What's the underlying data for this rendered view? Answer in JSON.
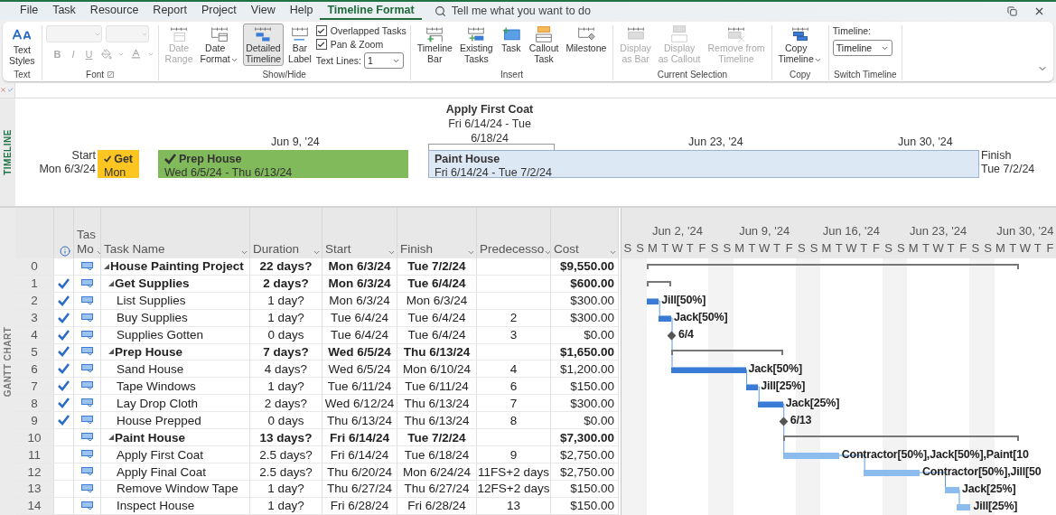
{
  "menu": {
    "tabs": [
      {
        "label": "File",
        "selected": false
      },
      {
        "label": "Task",
        "selected": false
      },
      {
        "label": "Resource",
        "selected": false
      },
      {
        "label": "Report",
        "selected": false
      },
      {
        "label": "Project",
        "selected": false
      },
      {
        "label": "View",
        "selected": false
      },
      {
        "label": "Help",
        "selected": false
      },
      {
        "label": "Timeline Format",
        "selected": true
      }
    ],
    "search": {
      "placeholder": "Tell me what you want to do"
    }
  },
  "ribbon": {
    "groups": [
      {
        "kind": "buttons",
        "label": "Text",
        "buttons": [
          {
            "label": "Text\nStyles",
            "disabled": false,
            "pressed": false,
            "dropdown": false
          }
        ]
      },
      {
        "kind": "font",
        "label": "Font",
        "disabled": true,
        "format_buttons": [
          "B",
          "I",
          "U"
        ]
      },
      {
        "kind": "buttons",
        "label": "Show/Hide",
        "buttons": [
          {
            "label": "Date\nRange",
            "disabled": true,
            "pressed": false,
            "dropdown": false
          },
          {
            "label": "Date\nFormat",
            "disabled": false,
            "pressed": false,
            "dropdown": true
          },
          {
            "label": "Detailed\nTimeline",
            "disabled": false,
            "pressed": true,
            "dropdown": false
          },
          {
            "label": "Bar\nLabel",
            "disabled": false,
            "pressed": false,
            "dropdown": false
          }
        ],
        "checkboxes": [
          {
            "label": "Overlapped Tasks",
            "checked": true
          },
          {
            "label": "Pan & Zoom",
            "checked": true
          }
        ],
        "select": {
          "label": "Text Lines:",
          "value": "1"
        }
      },
      {
        "kind": "buttons",
        "label": "Insert",
        "buttons": [
          {
            "label": "Timeline\nBar",
            "disabled": false,
            "pressed": false,
            "dropdown": false
          },
          {
            "label": "Existing\nTasks",
            "disabled": false,
            "pressed": false,
            "dropdown": false
          },
          {
            "label": "Task",
            "disabled": false,
            "pressed": false,
            "dropdown": false
          },
          {
            "label": "Callout\nTask",
            "disabled": false,
            "pressed": false,
            "dropdown": false
          },
          {
            "label": "Milestone",
            "disabled": false,
            "pressed": false,
            "dropdown": false
          }
        ]
      },
      {
        "kind": "buttons",
        "label": "Current Selection",
        "buttons": [
          {
            "label": "Display\nas Bar",
            "disabled": true,
            "pressed": false,
            "dropdown": false
          },
          {
            "label": "Display\nas Callout",
            "disabled": true,
            "pressed": false,
            "dropdown": false
          },
          {
            "label": "Remove from\nTimeline",
            "disabled": true,
            "pressed": false,
            "dropdown": false
          }
        ]
      },
      {
        "kind": "buttons",
        "label": "Copy",
        "buttons": [
          {
            "label": "Copy\nTimeline",
            "disabled": false,
            "pressed": false,
            "dropdown": true
          }
        ]
      },
      {
        "kind": "switch",
        "label": "Switch Timeline",
        "select": {
          "label": "Timeline:",
          "value": "Timeline"
        }
      }
    ]
  },
  "timeline": {
    "side_label": "TIMELINE",
    "start_label": "Start",
    "start_date": "Mon 6/3/24",
    "finish_label": "Finish",
    "finish_date": "Tue 7/2/24",
    "scale": [
      "Jun 9, '24",
      "Jun 23, '24",
      "Jun 30, '24"
    ],
    "bars": [
      {
        "name": "Get",
        "dates": "Mon",
        "complete": true,
        "color": "#fcc521"
      },
      {
        "name": "Prep House",
        "dates": "Wed 6/5/24 - Thu 6/13/24",
        "complete": true,
        "color": "#80ba5a"
      },
      {
        "name": "Paint House",
        "dates": "Fri 6/14/24 - Tue 7/2/24",
        "complete": false,
        "color": "#dde8f5"
      }
    ],
    "callout": {
      "name": "Apply First Coat",
      "dates": "Fri 6/14/24 - Tue 6/18/24"
    }
  },
  "gantt": {
    "side_label": "GANTT CHART",
    "columns": [
      "Tas Mo",
      "Task Name",
      "Duration",
      "Start",
      "Finish",
      "Predecesso",
      "Cost"
    ],
    "weeks": [
      "Jun 2, '24",
      "Jun 9, '24",
      "Jun 16, '24",
      "Jun 23, '24",
      "Jun 30, '24"
    ],
    "days": [
      "S",
      "S",
      "M",
      "T",
      "W",
      "T",
      "F",
      "S",
      "S",
      "M",
      "T",
      "W",
      "T",
      "F",
      "S",
      "S",
      "M",
      "T",
      "W",
      "T",
      "F",
      "S",
      "S",
      "M",
      "T",
      "W",
      "T",
      "F",
      "S",
      "S",
      "M",
      "T",
      "W",
      "T",
      "F"
    ],
    "rows": [
      {
        "id": "0",
        "name": "House Painting Project",
        "duration": "22 days?",
        "start": "Mon 6/3/24",
        "finish": "Tue 7/2/24",
        "cost": "$9,550.00",
        "complete": false,
        "children": [
          {
            "id": "1",
            "name": "Get Supplies",
            "duration": "2 days?",
            "start": "Mon 6/3/24",
            "finish": "Tue 6/4/24",
            "cost": "$600.00",
            "complete": true,
            "children": [
              {
                "id": "2",
                "name": "List Supplies",
                "duration": "1 day?",
                "start": "Mon 6/3/24",
                "finish": "Mon 6/3/24",
                "cost": "$300.00",
                "complete": true,
                "bar_label": "Jill[50%]"
              },
              {
                "id": "3",
                "name": "Buy Supplies",
                "duration": "1 day?",
                "start": "Tue 6/4/24",
                "finish": "Tue 6/4/24",
                "predecessors": "2",
                "cost": "$300.00",
                "complete": true,
                "bar_label": "Jack[50%]"
              },
              {
                "id": "4",
                "name": "Supplies Gotten",
                "duration": "0 days",
                "start": "Tue 6/4/24",
                "finish": "Tue 6/4/24",
                "predecessors": "3",
                "cost": "$0.00",
                "complete": true,
                "bar_label": "6/4"
              }
            ]
          },
          {
            "id": "5",
            "name": "Prep House",
            "duration": "7 days?",
            "start": "Wed 6/5/24",
            "finish": "Thu 6/13/24",
            "cost": "$1,650.00",
            "complete": true,
            "children": [
              {
                "id": "6",
                "name": "Sand House",
                "duration": "4 days?",
                "start": "Wed 6/5/24",
                "finish": "Mon 6/10/24",
                "predecessors": "4",
                "cost": "$1,200.00",
                "complete": true,
                "bar_label": "Jack[50%]"
              },
              {
                "id": "7",
                "name": "Tape Windows",
                "duration": "1 day?",
                "start": "Tue 6/11/24",
                "finish": "Tue 6/11/24",
                "predecessors": "6",
                "cost": "$150.00",
                "complete": true,
                "bar_label": "Jill[25%]"
              },
              {
                "id": "8",
                "name": "Lay Drop Cloth",
                "duration": "2 days?",
                "start": "Wed 6/12/24",
                "finish": "Thu 6/13/24",
                "predecessors": "7",
                "cost": "$300.00",
                "complete": true,
                "bar_label": "Jack[25%]"
              },
              {
                "id": "9",
                "name": "House Prepped",
                "duration": "0 days",
                "start": "Thu 6/13/24",
                "finish": "Thu 6/13/24",
                "predecessors": "8",
                "cost": "$0.00",
                "complete": true,
                "bar_label": "6/13"
              }
            ]
          },
          {
            "id": "10",
            "name": "Paint House",
            "duration": "13 days?",
            "start": "Fri 6/14/24",
            "finish": "Tue 7/2/24",
            "cost": "$7,300.00",
            "complete": false,
            "children": [
              {
                "id": "11",
                "name": "Apply First Coat",
                "duration": "2.5 days?",
                "start": "Fri 6/14/24",
                "finish": "Tue 6/18/24",
                "predecessors": "9",
                "cost": "$2,750.00",
                "complete": false,
                "bar_label": "Contractor[50%],Jack[50%],Paint[10"
              },
              {
                "id": "12",
                "name": "Apply Final Coat",
                "duration": "2.5 days?",
                "start": "Thu 6/20/24",
                "finish": "Mon 6/24/24",
                "predecessors": "11FS+2 days",
                "cost": "$2,750.00",
                "complete": false,
                "bar_label": "Contractor[50%],Jill[50"
              },
              {
                "id": "13",
                "name": "Remove Window Tape",
                "duration": "1 day?",
                "start": "Thu 6/27/24",
                "finish": "Thu 6/27/24",
                "predecessors": "12FS+2 days",
                "cost": "$150.00",
                "complete": false,
                "bar_label": "Jack[25%]"
              },
              {
                "id": "14",
                "name": "Inspect House",
                "duration": "1 day?",
                "start": "Fri 6/28/24",
                "finish": "Fri 6/28/24",
                "predecessors": "13",
                "cost": "$150.00",
                "complete": false,
                "bar_label": "Jill[25%]"
              }
            ]
          }
        ]
      }
    ]
  }
}
